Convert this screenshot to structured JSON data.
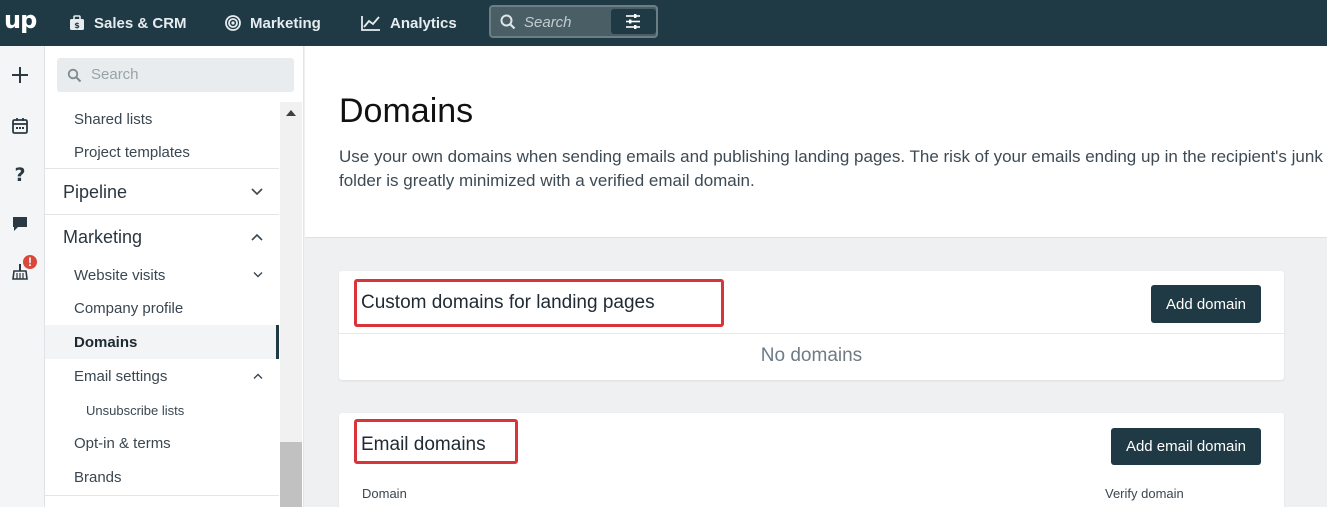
{
  "topbar": {
    "logo": "up",
    "nav": [
      {
        "label": "Sales & CRM",
        "icon": "briefcase-icon"
      },
      {
        "label": "Marketing",
        "icon": "target-icon"
      },
      {
        "label": "Analytics",
        "icon": "chart-icon"
      }
    ],
    "search_placeholder": "Search",
    "filter_icon": "sliders-icon"
  },
  "rail": {
    "icons": [
      "plus-icon",
      "calendar-icon",
      "help-icon",
      "chat-icon",
      "broom-icon"
    ],
    "badge": "!"
  },
  "sidebar": {
    "search_placeholder": "Search",
    "items": [
      {
        "label": "Shared lists",
        "level": "sub"
      },
      {
        "label": "Project templates",
        "level": "sub"
      },
      {
        "label": "Pipeline",
        "level": "head",
        "chevron": "down"
      },
      {
        "label": "Marketing",
        "level": "head",
        "chevron": "up"
      },
      {
        "label": "Website visits",
        "level": "sub",
        "chevron": "down"
      },
      {
        "label": "Company profile",
        "level": "sub"
      },
      {
        "label": "Domains",
        "level": "sub",
        "active": true
      },
      {
        "label": "Email settings",
        "level": "sub",
        "chevron": "up"
      },
      {
        "label": "Unsubscribe lists",
        "level": "subsub"
      },
      {
        "label": "Opt-in & terms",
        "level": "sub"
      },
      {
        "label": "Brands",
        "level": "sub"
      }
    ]
  },
  "main": {
    "title": "Domains",
    "description": "Use your own domains when sending emails and publishing landing pages. The risk of your emails ending up in the recipient's junk folder is greatly minimized with a verified email domain.",
    "landing": {
      "title": "Custom domains for landing pages",
      "button": "Add domain",
      "empty": "No domains"
    },
    "email": {
      "title": "Email domains",
      "button": "Add email domain",
      "columns": [
        "Domain",
        "Verify domain"
      ]
    }
  },
  "colors": {
    "topbar": "#1f3a44",
    "button": "#1f3a44",
    "highlight": "#d9343a",
    "badge": "#d9483b"
  }
}
